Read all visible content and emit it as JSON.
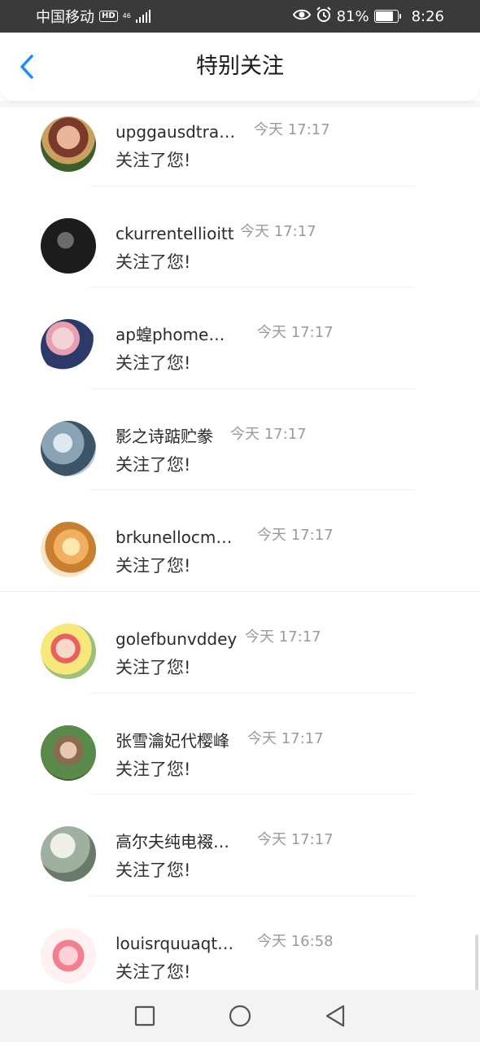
{
  "status_bar": {
    "carrier": "中国移动",
    "hd": "HD",
    "network": "46",
    "battery_percent": "81%",
    "battery_level": 0.81,
    "time": "8:26"
  },
  "header": {
    "title": "特别关注",
    "back_icon": "chevron-left-icon",
    "accent_color": "#1a8cff"
  },
  "items": [
    {
      "name": "upggausdtraliua",
      "time": "今天 17:17",
      "message": "关注了您!"
    },
    {
      "name": "ckurrentellioitt",
      "time": "今天 17:17",
      "message": "关注了您!"
    },
    {
      "name": "ap蝗phome获…",
      "time": "今天 17:17",
      "message": "关注了您!"
    },
    {
      "name": "影之诗踮贮豢",
      "time": "今天 17:17",
      "message": "关注了您!"
    },
    {
      "name": "brkunellocmu…",
      "time": "今天 17:17",
      "message": "关注了您!"
    },
    {
      "name": "golefbunvddey",
      "time": "今天 17:17",
      "message": "关注了您!"
    },
    {
      "name": "张雪瀹妃代樱峰",
      "time": "今天 17:17",
      "message": "关注了您!"
    },
    {
      "name": "高尔夫纯电裰…",
      "time": "今天 17:17",
      "message": "关注了您!"
    },
    {
      "name": "louisrquuaqto…",
      "time": "今天 16:58",
      "message": "关注了您!"
    }
  ],
  "nav": {
    "recents_icon": "square-icon",
    "home_icon": "circle-icon",
    "back_icon": "triangle-back-icon"
  }
}
